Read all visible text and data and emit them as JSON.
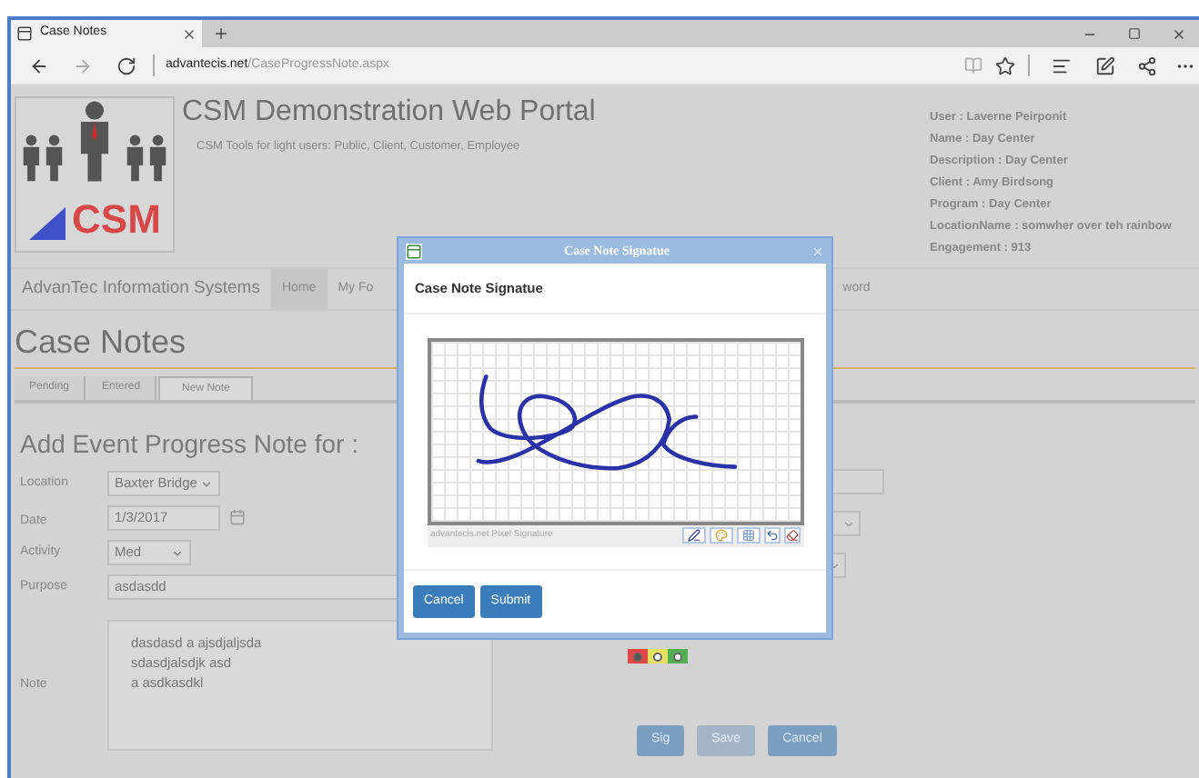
{
  "browser": {
    "tab_title": "Case Notes",
    "url_host": "advantecis.net",
    "url_path": "/CaseProgressNote.aspx"
  },
  "header": {
    "logo_text": "CSM",
    "title": "CSM Demonstration Web Portal",
    "subtitle": "CSM Tools for light users: Public, Client, Customer, Employee",
    "user_info": [
      "User : Laverne Peirponit",
      "Name : Day Center",
      "Description : Day Center",
      "Client : Amy Birdsong",
      "Program : Day Center",
      "LocationName : somwher over teh rainbow",
      "Engagement : 913"
    ]
  },
  "nav": {
    "brand": "AdvanTec Information Systems",
    "items": [
      {
        "label": "Home",
        "selected": true
      },
      {
        "label": "My Fo",
        "selected": false
      },
      {
        "label": "word",
        "selected": false
      }
    ]
  },
  "page_title": "Case Notes",
  "tabs": [
    {
      "label": "Pending",
      "selected": false
    },
    {
      "label": "Entered",
      "selected": false
    },
    {
      "label": "New Note",
      "selected": true
    }
  ],
  "form": {
    "heading": "Add Event Progress Note for :",
    "fields": [
      {
        "label": "Location",
        "kind": "select",
        "value": "Baxter Bridge"
      },
      {
        "label": "Date",
        "kind": "date",
        "value": "1/3/2017"
      },
      {
        "label": "Activity",
        "kind": "select",
        "value": "Med"
      },
      {
        "label": "Purpose",
        "kind": "text",
        "value": "asdasdd"
      },
      {
        "label": "Note",
        "kind": "textarea",
        "value": "dasdasd a  ajsdjaljsda\nsdasdjalsdjk asd\na asdkasdkl"
      }
    ],
    "side_fields": [
      {
        "kind": "text"
      },
      {
        "kind": "select"
      },
      {
        "kind": "select"
      }
    ],
    "status_colors": [
      {
        "color": "#e04848",
        "selected": true
      },
      {
        "color": "#e6e060",
        "selected": false
      },
      {
        "color": "#52b052",
        "selected": false
      }
    ],
    "buttons": [
      {
        "label": "Sig",
        "disabled": false
      },
      {
        "label": "Save",
        "disabled": true
      },
      {
        "label": "Cancel",
        "disabled": false
      }
    ]
  },
  "dialog": {
    "title": "Case Note Signatue",
    "heading": "Case Note Signatue",
    "pad_caption": "advantecis.net Pixel Signature",
    "buttons": [
      "Cancel",
      "Submit"
    ]
  }
}
